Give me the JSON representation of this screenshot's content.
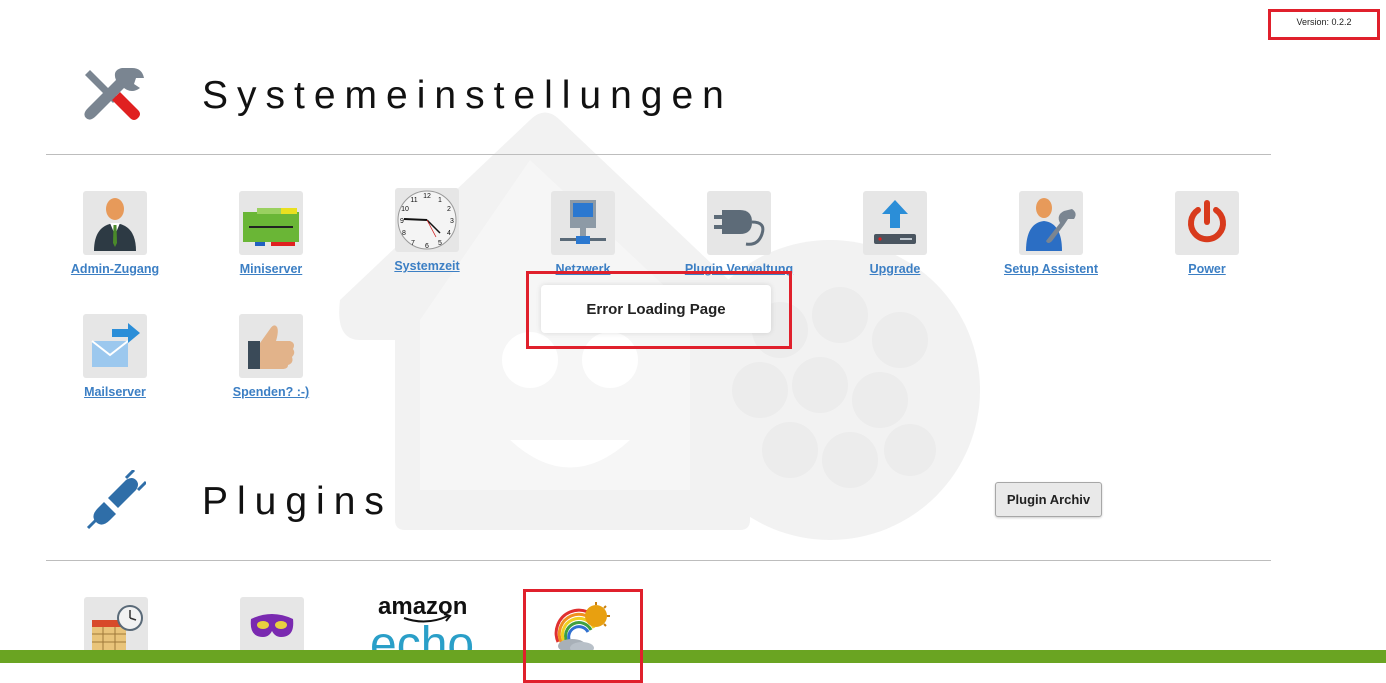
{
  "version": {
    "label": "Version: 0.2.2"
  },
  "system": {
    "title": "Systemeinstellungen",
    "tiles": [
      {
        "label": "Admin-Zugang",
        "icon": "admin-user-icon"
      },
      {
        "label": "Miniserver",
        "icon": "miniserver-icon"
      },
      {
        "label": "Systemzeit",
        "icon": "clock-icon"
      },
      {
        "label": "Netzwerk",
        "icon": "network-computer-icon"
      },
      {
        "label": "Plugin Verwaltung",
        "icon": "plug-icon"
      },
      {
        "label": "Upgrade",
        "icon": "upgrade-arrow-icon"
      },
      {
        "label": "Setup Assistent",
        "icon": "setup-wizard-icon"
      },
      {
        "label": "Power",
        "icon": "power-icon"
      },
      {
        "label": "Mailserver",
        "icon": "mail-icon"
      },
      {
        "label": "Spenden? :-)",
        "icon": "thumbs-up-icon"
      }
    ]
  },
  "plugins": {
    "title": "Plugins",
    "archive_button": "Plugin Archiv",
    "items": [
      {
        "icon": "calendar-clock-icon"
      },
      {
        "icon": "mask-icon"
      },
      {
        "icon": "amazon-echo-logo",
        "logo_text_top": "amazon",
        "logo_text_bottom": "echo"
      },
      {
        "icon": "weather-rainbow-icon"
      }
    ]
  },
  "dialog": {
    "message": "Error Loading Page"
  },
  "colors": {
    "accent": "#3c7fc4",
    "highlight": "#e0202c",
    "footer": "#6aa422"
  }
}
